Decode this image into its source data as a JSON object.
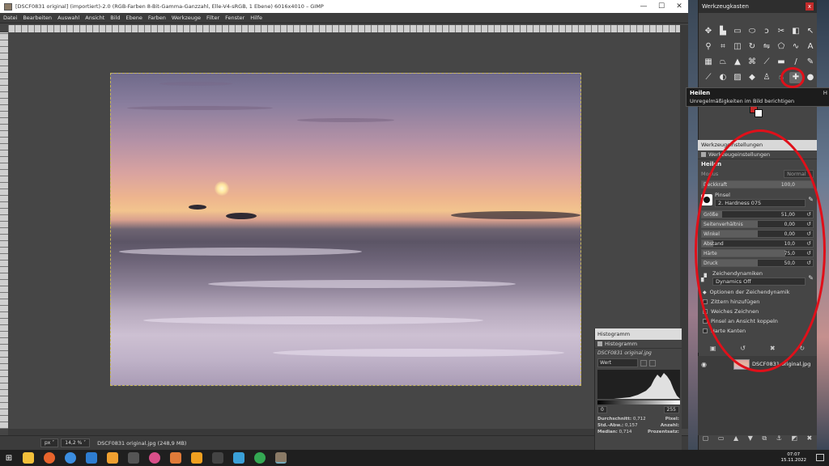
{
  "window": {
    "title": "[DSCF0831 original] (importiert)-2.0 (RGB-Farben 8-Bit-Gamma-Ganzzahl, Elle-V4-sRGB, 1 Ebene) 6016x4010 – GIMP",
    "minimize": "—",
    "maximize": "☐",
    "close": "✕"
  },
  "menu": [
    "Datei",
    "Bearbeiten",
    "Auswahl",
    "Ansicht",
    "Bild",
    "Ebene",
    "Farben",
    "Werkzeuge",
    "Filter",
    "Fenster",
    "Hilfe"
  ],
  "statusbar": {
    "unit": "px ˅",
    "zoom": "14,2 % ˅",
    "fileinfo": "DSCF0831 original.jpg (248,9 MB)"
  },
  "histogram": {
    "panel_title": "Histogramm",
    "sub_title": "Histogramm",
    "filename": "DSCF0831 original.jpg",
    "channel": "Wert",
    "range_min": "0",
    "range_max": "255",
    "stats": [
      {
        "label": "Durchschnitt:",
        "value": "0,712",
        "right": "Pixel:"
      },
      {
        "label": "Std.-Abw.:",
        "value": "0,157",
        "right": "Anzahl:"
      },
      {
        "label": "Median:",
        "value": "0,714",
        "right": "Prozentsatz:"
      }
    ]
  },
  "toolbox": {
    "title": "Werkzeugkasten",
    "close": "x",
    "tooltip_title": "Heilen",
    "tooltip_key": "H",
    "tooltip_desc": "Unregelmäßigkeiten im Bild berichtigen",
    "colors": {
      "foreground": "#c62828",
      "background": "#ffffff"
    }
  },
  "tool_options": {
    "header": "Werkzeugeinstellungen",
    "sub_title": "Werkzeugeinstellungen",
    "tool_name": "Heilen",
    "mode_label": "Modus",
    "mode_value": "Normal ˅",
    "opacity": {
      "label": "Deckkraft",
      "value": "100,0",
      "fraction": 1.0
    },
    "brush_label": "Pinsel",
    "brush_value": "2. Hardness 075",
    "size": {
      "label": "Größe",
      "value": "51,00",
      "fraction": 0.18
    },
    "aspect": {
      "label": "Seitenverhältnis",
      "value": "0,00",
      "fraction": 0.5
    },
    "angle": {
      "label": "Winkel",
      "value": "0,00",
      "fraction": 0.5
    },
    "spacing": {
      "label": "Abstand",
      "value": "10,0",
      "fraction": 0.1
    },
    "hardness": {
      "label": "Härte",
      "value": "75,0",
      "fraction": 0.75
    },
    "pressure": {
      "label": "Druck",
      "value": "50,0",
      "fraction": 0.5
    },
    "dynamics_label": "Zeichendynamiken",
    "dynamics_value": "Dynamics Off",
    "options": [
      "Optionen der Zeichendynamik",
      "Zittern hinzufügen",
      "Weiches Zeichnen",
      "Pinsel an Ansicht koppeln",
      "Harte Kanten"
    ]
  },
  "layers": {
    "name": "DSCF0831 original.jpg"
  },
  "taskbar": {
    "time": "07:07",
    "date": "15.11.2022"
  }
}
